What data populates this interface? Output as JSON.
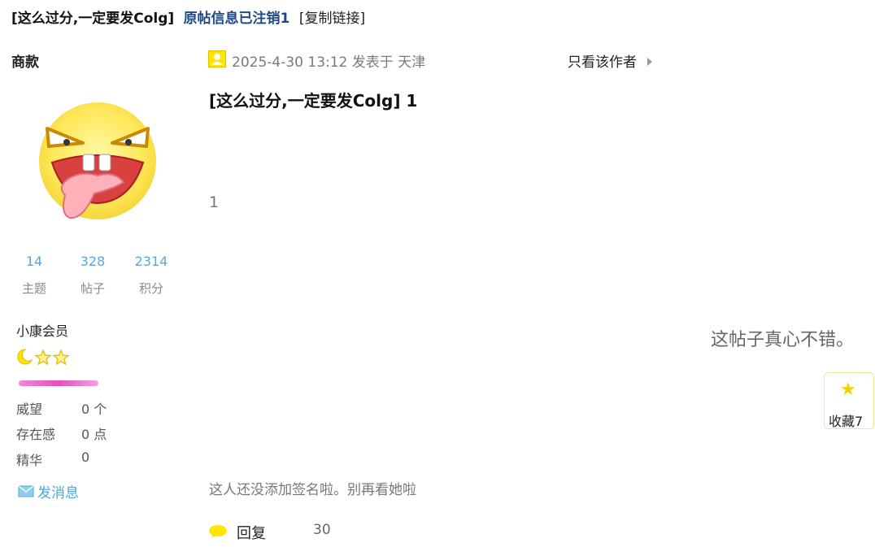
{
  "header": {
    "thread_title": "[这么过分,一定要发Colg]",
    "original_deleted": "原帖信息已注销1",
    "copy_link": "[复制链接]"
  },
  "user": {
    "name": "商款",
    "avatar_icon": "tongue-out-emoji-icon",
    "stats": [
      {
        "value": "14",
        "label": "主题"
      },
      {
        "value": "328",
        "label": "帖子"
      },
      {
        "value": "2314",
        "label": "积分"
      }
    ],
    "member_level": "小康会员",
    "level_icons": [
      "moon-icon",
      "star-icon",
      "star-icon"
    ],
    "attributes": [
      {
        "label": "威望",
        "value": "0 个"
      },
      {
        "label": "存在感",
        "value": "0 点"
      },
      {
        "label": "精华",
        "value": "0"
      }
    ],
    "send_message": "发消息"
  },
  "post": {
    "time_location": "2025-4-30 13:12 发表于 天津",
    "author_only": "只看该作者",
    "title": "[这么过分,一定要发Colg] 1",
    "body": "1",
    "side_text": "这帖子真心不错。",
    "favorite_label": "收藏7",
    "signature": "这人还没添加签名啦。别再看她啦",
    "reply_label": "回复",
    "reply_count": "30"
  },
  "colors": {
    "link_blue": "#1f4a8a",
    "stat_blue": "#5aa7d8",
    "level_pink": "#e54ec0",
    "icon_yellow": "#f5d000"
  }
}
